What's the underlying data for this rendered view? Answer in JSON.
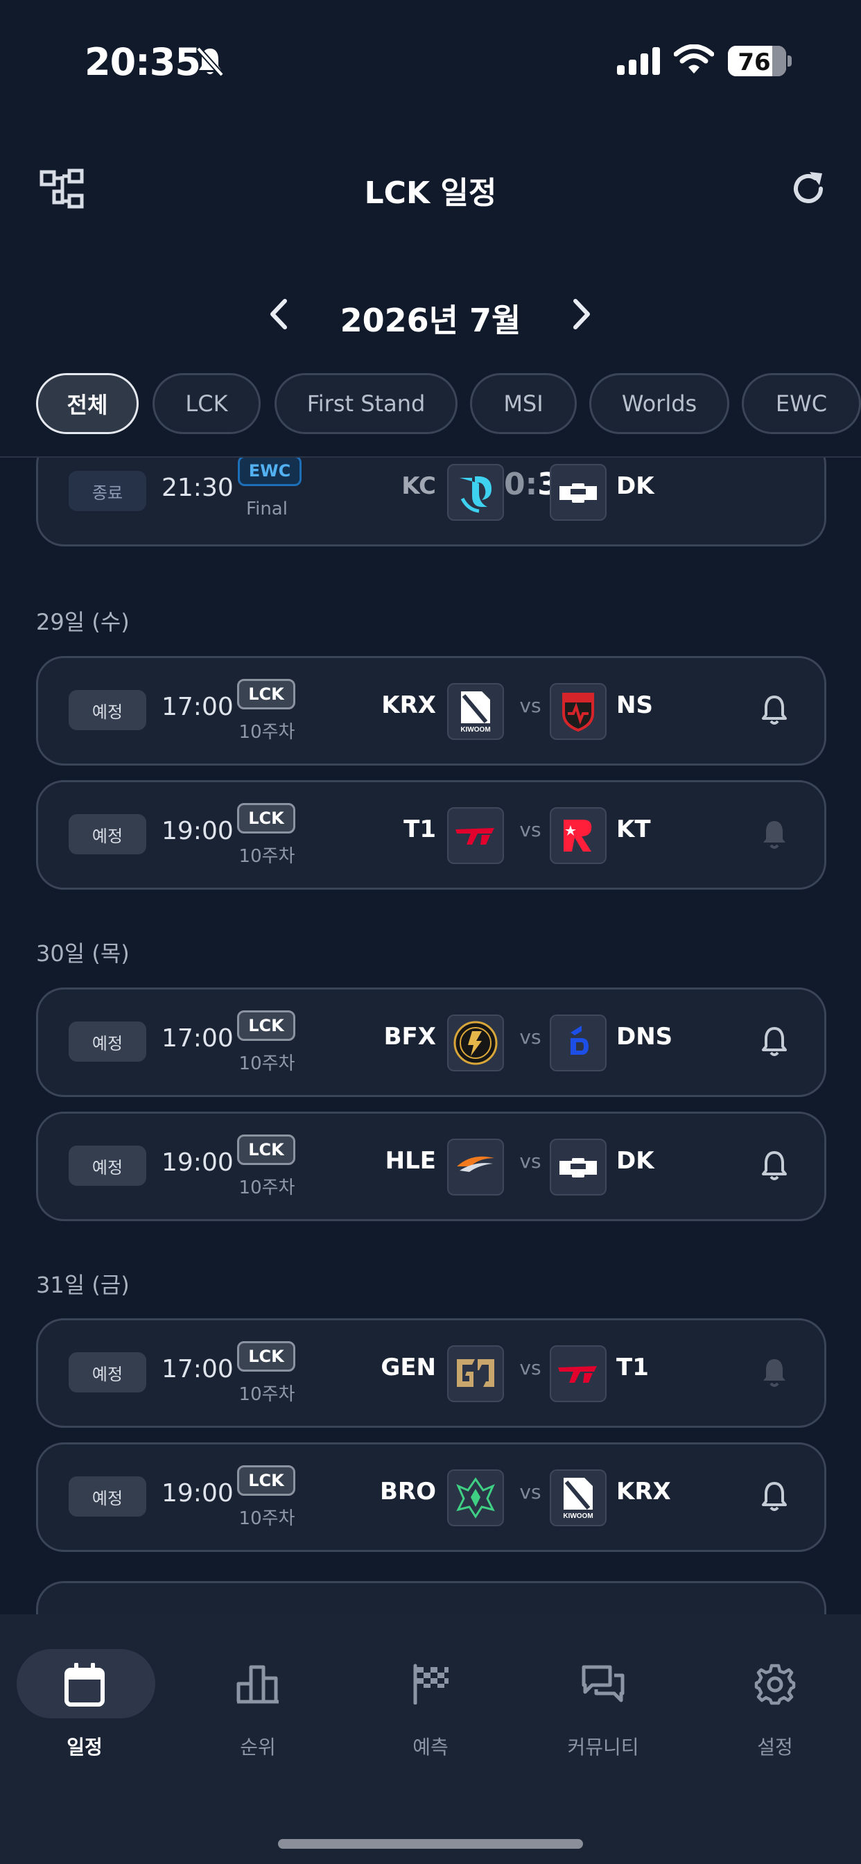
{
  "status_bar": {
    "time": "20:35",
    "battery": "76",
    "battery_level": 0.76
  },
  "header": {
    "title": "LCK 일정"
  },
  "month_nav": {
    "label": "2026년 7월"
  },
  "filters": [
    {
      "label": "전체",
      "active": true
    },
    {
      "label": "LCK",
      "active": false
    },
    {
      "label": "First Stand",
      "active": false
    },
    {
      "label": "MSI",
      "active": false
    },
    {
      "label": "Worlds",
      "active": false
    },
    {
      "label": "EWC",
      "active": false
    }
  ],
  "top_match": {
    "status": "종료",
    "time": "21:30",
    "league": "EWC",
    "round": "Final",
    "team_left": "KC",
    "score_left": "0",
    "score_sep": ":",
    "score_right": "3",
    "team_right": "DK"
  },
  "days": [
    {
      "label": "29일 (수)",
      "matches": [
        {
          "status": "예정",
          "time": "17:00",
          "league": "LCK",
          "round": "10주차",
          "team_left": "KRX",
          "vs": "vs",
          "team_right": "NS",
          "alarm": true
        },
        {
          "status": "예정",
          "time": "19:00",
          "league": "LCK",
          "round": "10주차",
          "team_left": "T1",
          "vs": "vs",
          "team_right": "KT",
          "alarm": false
        }
      ]
    },
    {
      "label": "30일 (목)",
      "matches": [
        {
          "status": "예정",
          "time": "17:00",
          "league": "LCK",
          "round": "10주차",
          "team_left": "BFX",
          "vs": "vs",
          "team_right": "DNS",
          "alarm": true
        },
        {
          "status": "예정",
          "time": "19:00",
          "league": "LCK",
          "round": "10주차",
          "team_left": "HLE",
          "vs": "vs",
          "team_right": "DK",
          "alarm": true
        }
      ]
    },
    {
      "label": "31일 (금)",
      "matches": [
        {
          "status": "예정",
          "time": "17:00",
          "league": "LCK",
          "round": "10주차",
          "team_left": "GEN",
          "vs": "vs",
          "team_right": "T1",
          "alarm": false
        },
        {
          "status": "예정",
          "time": "19:00",
          "league": "LCK",
          "round": "10주차",
          "team_left": "BRO",
          "vs": "vs",
          "team_right": "KRX",
          "alarm": true
        }
      ]
    }
  ],
  "logo_text": {
    "kiwoom": "KIWOOM"
  },
  "colors": {
    "background": "#111a2b",
    "card": "#1a2333",
    "ewc_accent": "#53b1f2",
    "t1_red": "#e2012d",
    "kt_red": "#ff1f3a",
    "gen_gold": "#c9a66b",
    "bro_green": "#3fd084",
    "dns_blue": "#1d4ee6"
  },
  "bottom_nav": [
    {
      "label": "일정",
      "icon": "calendar-icon",
      "active": true
    },
    {
      "label": "순위",
      "icon": "bar-chart-icon",
      "active": false
    },
    {
      "label": "예측",
      "icon": "checkered-flag-icon",
      "active": false
    },
    {
      "label": "커뮤니티",
      "icon": "chat-bubbles-icon",
      "active": false
    },
    {
      "label": "설정",
      "icon": "gear-icon",
      "active": false
    }
  ]
}
